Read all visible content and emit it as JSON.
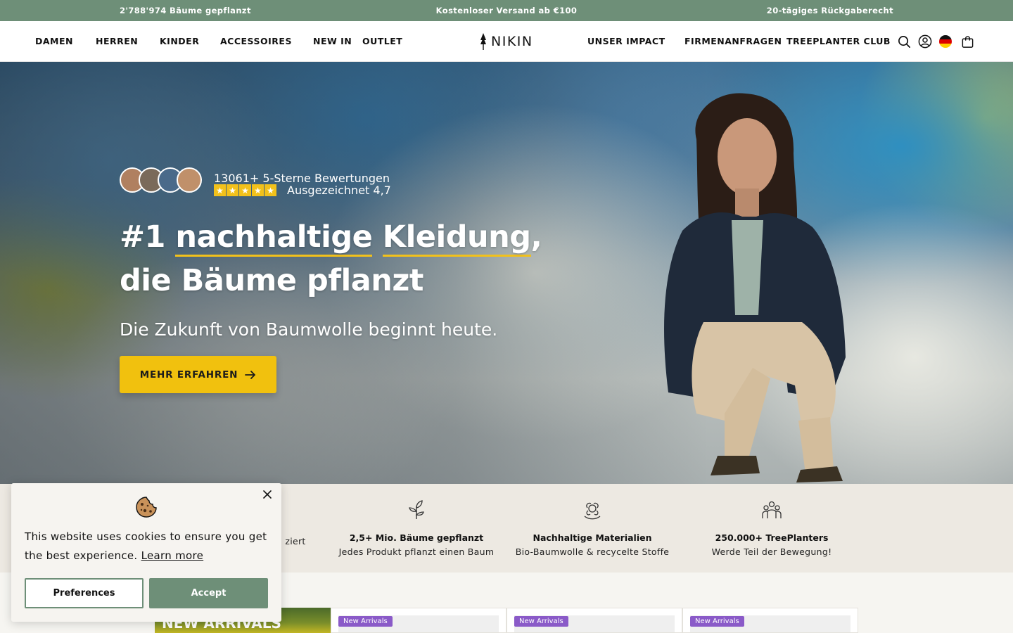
{
  "announcement": {
    "left": "2'788'974 Bäume gepflanzt",
    "center": "Kostenloser Versand ab €100",
    "right": "20-tägiges Rückgaberecht"
  },
  "nav": {
    "left": [
      "DAMEN",
      "HERREN",
      "KINDER",
      "ACCESSOIRES",
      "NEW IN",
      "OUTLET"
    ],
    "logo": "NIKIN",
    "right": [
      "UNSER IMPACT",
      "FIRMENANFRAGEN",
      "TREEPLANTER CLUB"
    ],
    "icons": [
      "search-icon",
      "account-icon",
      "flag-de-icon",
      "cart-icon"
    ]
  },
  "hero": {
    "reviews_count": "13061+ 5-Sterne Bewertungen",
    "rating_text": "Ausgezeichnet 4,7",
    "stars": 5,
    "headline_prefix": "#1 ",
    "headline_u1": "nachhaltige",
    "headline_u2": "Kleidung",
    "headline_comma": ",",
    "headline_line2": "die Bäume pflanzt",
    "subline": "Die Zukunft von Baumwolle beginnt heute.",
    "cta": "MEHR ERFAHREN"
  },
  "features": [
    {
      "icon": "certificate-icon",
      "title": "",
      "sub": "ziert"
    },
    {
      "icon": "sprout-icon",
      "title": "2,5+ Mio. Bäume gepflanzt",
      "sub": "Jedes Produkt pflanzt einen Baum"
    },
    {
      "icon": "cotton-icon",
      "title": "Nachhaltige Materialien",
      "sub": "Bio-Baumwolle & recycelte Stoffe"
    },
    {
      "icon": "community-icon",
      "title": "250.000+ TreePlanters",
      "sub": "Werde Teil der Bewegung!"
    }
  ],
  "arrivals": {
    "banner": "NEW ARRIVALS",
    "badge": "New Arrivals"
  },
  "cookie": {
    "text": "This website uses cookies to ensure you get the best experience.",
    "learn_more": "Learn more",
    "preferences": "Preferences",
    "accept": "Accept"
  },
  "colors": {
    "sage": "#6e8f78",
    "yellow": "#f1c10e",
    "badge_purple": "#8a5ac8"
  }
}
